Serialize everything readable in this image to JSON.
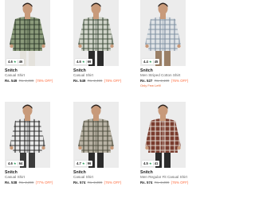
{
  "products": [
    {
      "brand": "Snitch",
      "name": "Casual Shirt",
      "rating": "4.6",
      "reviews": "46",
      "price": "Rs. 549",
      "mrp": "Rs. 2,499",
      "discount": "(78% OFF)",
      "note": "",
      "shirt_color": "#8a9a7a",
      "check_color": "#2f3b2c",
      "pants_color": "#e4e2dc"
    },
    {
      "brand": "Snitch",
      "name": "Casual Shirt",
      "rating": "4.6",
      "reviews": "66",
      "price": "Rs. 549",
      "mrp": "Rs. 2,499",
      "discount": "(78% OFF)",
      "note": "",
      "shirt_color": "#cfd3c8",
      "check_color": "#3b4a38",
      "pants_color": "#2b2b2b"
    },
    {
      "brand": "Snitch",
      "name": "Men Striped Cotton Shirt",
      "rating": "4.4",
      "reviews": "45",
      "price": "Rs. 527",
      "mrp": "Rs. 2,199",
      "discount": "(76% OFF)",
      "note": "Only Few Left!",
      "shirt_color": "#dfe3e6",
      "check_color": "#7d8ea0",
      "pants_color": "#9a7f66"
    },
    {
      "brand": "Snitch",
      "name": "Casual Shirt",
      "rating": "4.6",
      "reviews": "64",
      "price": "Rs. 538",
      "mrp": "Rs. 2,299",
      "discount": "(77% OFF)",
      "note": "",
      "shirt_color": "#e9e9e9",
      "check_color": "#1e1e1e",
      "pants_color": "#3b3b3b"
    },
    {
      "brand": "Snitch",
      "name": "Casual Shirt",
      "rating": "4.7",
      "reviews": "96",
      "price": "Rs. 574",
      "mrp": "Rs. 2,399",
      "discount": "(76% OFF)",
      "note": "",
      "shirt_color": "#b8b2a4",
      "check_color": "#4b4b3b",
      "pants_color": "#2b2b2b"
    },
    {
      "brand": "Snitch",
      "name": "Men Regular Fit Casual Shirt",
      "rating": "4.5",
      "reviews": "41",
      "price": "Rs. 574",
      "mrp": "Rs. 2,399",
      "discount": "(76% OFF)",
      "note": "",
      "shirt_color": "#7a3c2e",
      "check_color": "#e8e0d8",
      "pants_color": "#2b2b2b"
    }
  ],
  "colors": {
    "rating_star": "#2a9d5c",
    "discount": "#ff6b3d",
    "note": "#e8622c"
  }
}
